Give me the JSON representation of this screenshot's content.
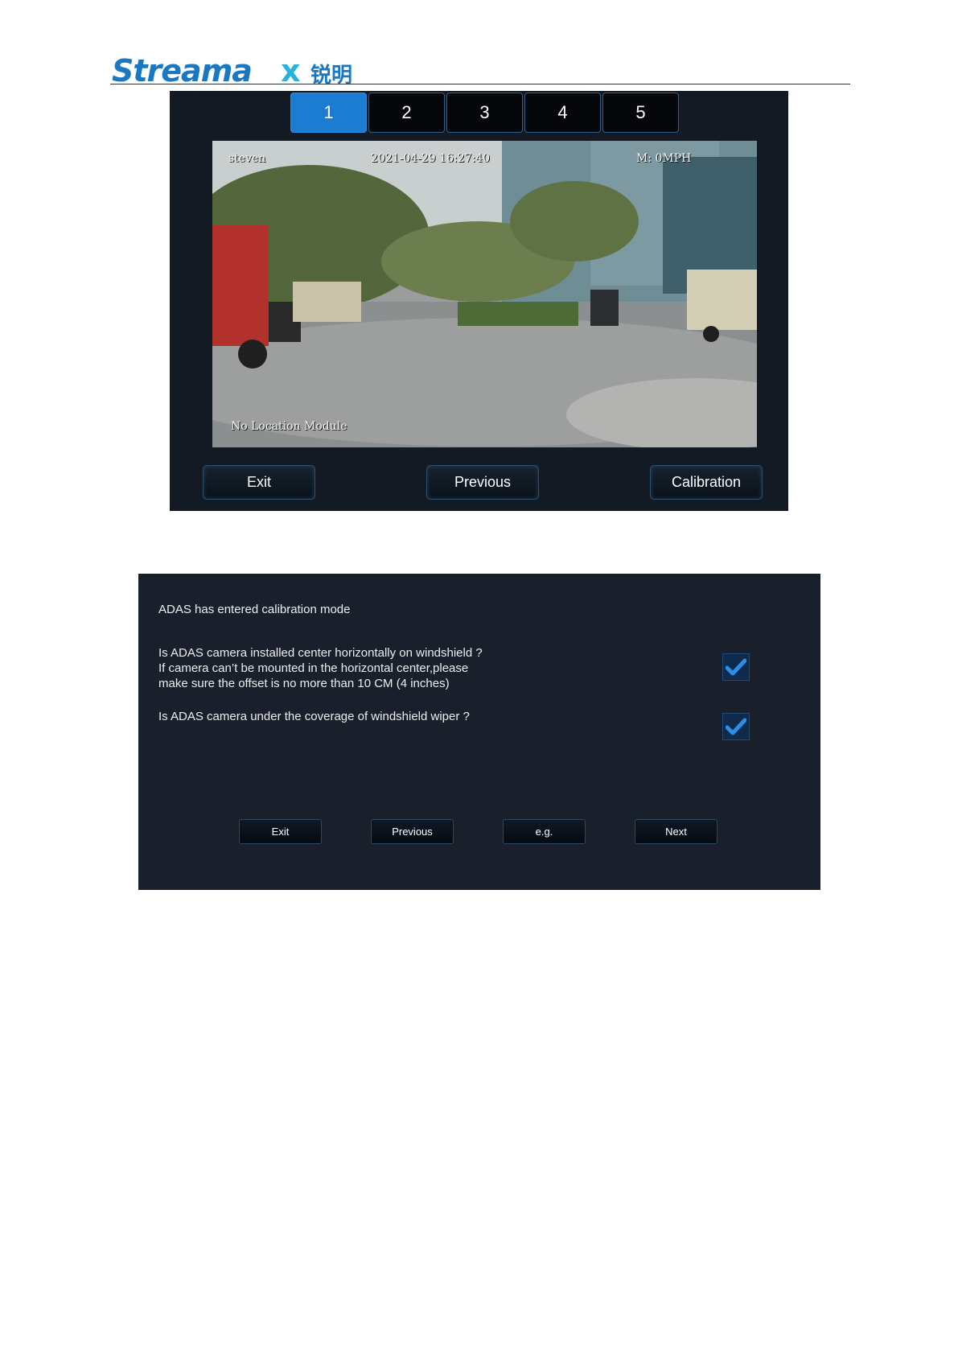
{
  "header": {
    "brand_latin": "Streamax",
    "brand_cjk": "锐明"
  },
  "panel1": {
    "tabs": [
      "1",
      "2",
      "3",
      "4",
      "5"
    ],
    "active_tab": "1",
    "camera": {
      "name": "steven",
      "datetime": "2021-04-29 16:27:40",
      "speed": "M: 0MPH",
      "location": "No Location Module"
    },
    "buttons": {
      "exit": "Exit",
      "previous": "Previous",
      "calibration": "Calibration"
    }
  },
  "panel2": {
    "title": "ADAS has entered calibration mode",
    "question1": {
      "line1": "Is ADAS camera installed center horizontally on windshield ?",
      "line2": "If camera can’t be mounted in the horizontal center,please",
      "line3": "make sure the offset is no more than 10 CM (4 inches)",
      "checked": true
    },
    "question2": {
      "text": "Is ADAS camera under the coverage of windshield wiper ?",
      "checked": true
    },
    "buttons": {
      "exit": "Exit",
      "previous": "Previous",
      "eg": "e.g.",
      "next": "Next"
    }
  },
  "colors": {
    "logo_blue": "#1a78c2",
    "logo_cyan": "#27b3d9",
    "active_tab": "#1c7cd1",
    "panel_bg": "#141a24",
    "check_blue": "#2a8de8"
  }
}
